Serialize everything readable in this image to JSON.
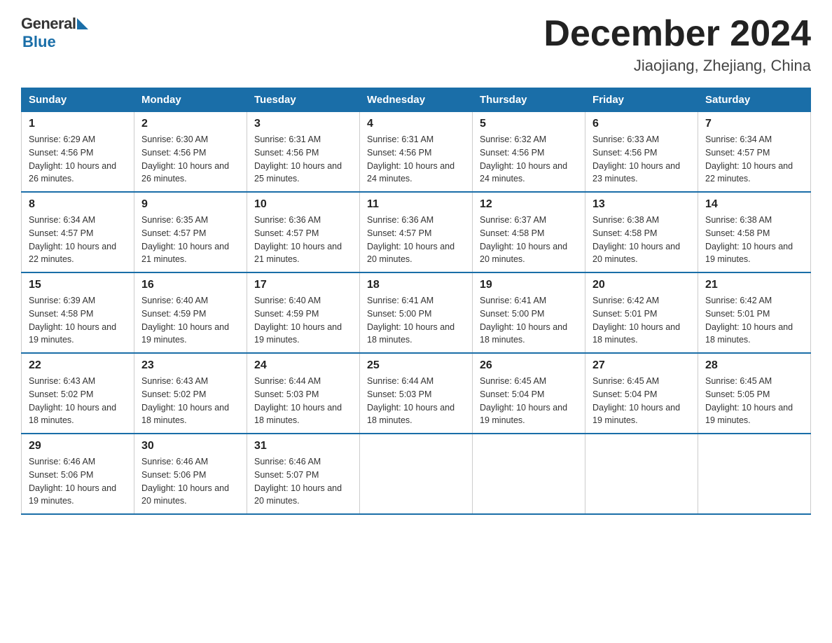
{
  "logo": {
    "general": "General",
    "blue": "Blue"
  },
  "title": "December 2024",
  "subtitle": "Jiaojiang, Zhejiang, China",
  "days_of_week": [
    "Sunday",
    "Monday",
    "Tuesday",
    "Wednesday",
    "Thursday",
    "Friday",
    "Saturday"
  ],
  "weeks": [
    [
      {
        "day": "1",
        "sunrise": "6:29 AM",
        "sunset": "4:56 PM",
        "daylight": "10 hours and 26 minutes."
      },
      {
        "day": "2",
        "sunrise": "6:30 AM",
        "sunset": "4:56 PM",
        "daylight": "10 hours and 26 minutes."
      },
      {
        "day": "3",
        "sunrise": "6:31 AM",
        "sunset": "4:56 PM",
        "daylight": "10 hours and 25 minutes."
      },
      {
        "day": "4",
        "sunrise": "6:31 AM",
        "sunset": "4:56 PM",
        "daylight": "10 hours and 24 minutes."
      },
      {
        "day": "5",
        "sunrise": "6:32 AM",
        "sunset": "4:56 PM",
        "daylight": "10 hours and 24 minutes."
      },
      {
        "day": "6",
        "sunrise": "6:33 AM",
        "sunset": "4:56 PM",
        "daylight": "10 hours and 23 minutes."
      },
      {
        "day": "7",
        "sunrise": "6:34 AM",
        "sunset": "4:57 PM",
        "daylight": "10 hours and 22 minutes."
      }
    ],
    [
      {
        "day": "8",
        "sunrise": "6:34 AM",
        "sunset": "4:57 PM",
        "daylight": "10 hours and 22 minutes."
      },
      {
        "day": "9",
        "sunrise": "6:35 AM",
        "sunset": "4:57 PM",
        "daylight": "10 hours and 21 minutes."
      },
      {
        "day": "10",
        "sunrise": "6:36 AM",
        "sunset": "4:57 PM",
        "daylight": "10 hours and 21 minutes."
      },
      {
        "day": "11",
        "sunrise": "6:36 AM",
        "sunset": "4:57 PM",
        "daylight": "10 hours and 20 minutes."
      },
      {
        "day": "12",
        "sunrise": "6:37 AM",
        "sunset": "4:58 PM",
        "daylight": "10 hours and 20 minutes."
      },
      {
        "day": "13",
        "sunrise": "6:38 AM",
        "sunset": "4:58 PM",
        "daylight": "10 hours and 20 minutes."
      },
      {
        "day": "14",
        "sunrise": "6:38 AM",
        "sunset": "4:58 PM",
        "daylight": "10 hours and 19 minutes."
      }
    ],
    [
      {
        "day": "15",
        "sunrise": "6:39 AM",
        "sunset": "4:58 PM",
        "daylight": "10 hours and 19 minutes."
      },
      {
        "day": "16",
        "sunrise": "6:40 AM",
        "sunset": "4:59 PM",
        "daylight": "10 hours and 19 minutes."
      },
      {
        "day": "17",
        "sunrise": "6:40 AM",
        "sunset": "4:59 PM",
        "daylight": "10 hours and 19 minutes."
      },
      {
        "day": "18",
        "sunrise": "6:41 AM",
        "sunset": "5:00 PM",
        "daylight": "10 hours and 18 minutes."
      },
      {
        "day": "19",
        "sunrise": "6:41 AM",
        "sunset": "5:00 PM",
        "daylight": "10 hours and 18 minutes."
      },
      {
        "day": "20",
        "sunrise": "6:42 AM",
        "sunset": "5:01 PM",
        "daylight": "10 hours and 18 minutes."
      },
      {
        "day": "21",
        "sunrise": "6:42 AM",
        "sunset": "5:01 PM",
        "daylight": "10 hours and 18 minutes."
      }
    ],
    [
      {
        "day": "22",
        "sunrise": "6:43 AM",
        "sunset": "5:02 PM",
        "daylight": "10 hours and 18 minutes."
      },
      {
        "day": "23",
        "sunrise": "6:43 AM",
        "sunset": "5:02 PM",
        "daylight": "10 hours and 18 minutes."
      },
      {
        "day": "24",
        "sunrise": "6:44 AM",
        "sunset": "5:03 PM",
        "daylight": "10 hours and 18 minutes."
      },
      {
        "day": "25",
        "sunrise": "6:44 AM",
        "sunset": "5:03 PM",
        "daylight": "10 hours and 18 minutes."
      },
      {
        "day": "26",
        "sunrise": "6:45 AM",
        "sunset": "5:04 PM",
        "daylight": "10 hours and 19 minutes."
      },
      {
        "day": "27",
        "sunrise": "6:45 AM",
        "sunset": "5:04 PM",
        "daylight": "10 hours and 19 minutes."
      },
      {
        "day": "28",
        "sunrise": "6:45 AM",
        "sunset": "5:05 PM",
        "daylight": "10 hours and 19 minutes."
      }
    ],
    [
      {
        "day": "29",
        "sunrise": "6:46 AM",
        "sunset": "5:06 PM",
        "daylight": "10 hours and 19 minutes."
      },
      {
        "day": "30",
        "sunrise": "6:46 AM",
        "sunset": "5:06 PM",
        "daylight": "10 hours and 20 minutes."
      },
      {
        "day": "31",
        "sunrise": "6:46 AM",
        "sunset": "5:07 PM",
        "daylight": "10 hours and 20 minutes."
      },
      null,
      null,
      null,
      null
    ]
  ]
}
